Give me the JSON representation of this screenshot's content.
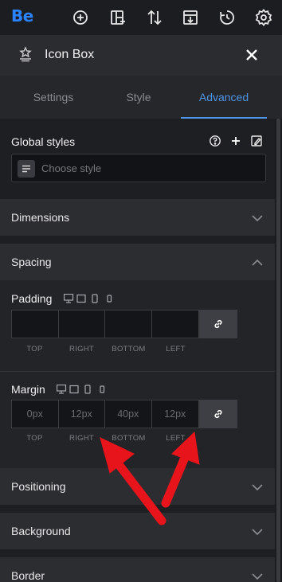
{
  "app": {
    "logo": "Be"
  },
  "toolbar": {
    "icons": [
      "add-icon",
      "layout-add-icon",
      "sort-arrows-icon",
      "export-icon",
      "history-icon",
      "settings-gear-icon"
    ]
  },
  "panel": {
    "title": "Icon Box"
  },
  "tabs": [
    {
      "label": "Settings",
      "active": false
    },
    {
      "label": "Style",
      "active": false
    },
    {
      "label": "Advanced",
      "active": true
    }
  ],
  "global_styles": {
    "title": "Global styles",
    "placeholder": "Choose style"
  },
  "sections": {
    "dimensions": "Dimensions",
    "spacing": "Spacing",
    "positioning": "Positioning",
    "background": "Background",
    "border": "Border"
  },
  "padding": {
    "label": "Padding",
    "values": [
      "",
      "",
      "",
      ""
    ],
    "sides": [
      "TOP",
      "RIGHT",
      "BOTTOM",
      "LEFT"
    ]
  },
  "margin": {
    "label": "Margin",
    "placeholders": [
      "0px",
      "12px",
      "40px",
      "12px"
    ],
    "sides": [
      "TOP",
      "RIGHT",
      "BOTTOM",
      "LEFT"
    ]
  },
  "colors": {
    "accent": "#4e95e8",
    "logo": "#2a83ff",
    "annotation_arrow": "#e8141b"
  }
}
